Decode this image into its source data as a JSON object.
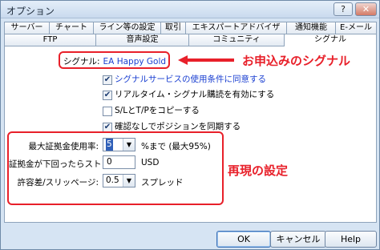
{
  "window": {
    "title": "オプション",
    "help_glyph": "?",
    "close_glyph": "✕"
  },
  "tabs_row1": [
    "サーバー",
    "チャート",
    "ライン等の設定",
    "取引",
    "エキスパートアドバイザ",
    "通知機能",
    "E-メール"
  ],
  "tabs_row2": [
    "FTP",
    "音声設定",
    "コミュニティ",
    "シグナル"
  ],
  "active_tab": "シグナル",
  "signal": {
    "label": "シグナル:",
    "name": "EA Happy Gold"
  },
  "annotations": {
    "callout_signal": "お申込みのシグナル",
    "callout_settings": "再現の設定",
    "accent_color": "#e8202a"
  },
  "checkboxes": [
    {
      "label": "シグナルサービスの使用条件に同意する",
      "checked": true,
      "link": true
    },
    {
      "label": "リアルタイム・シグナル購読を有効にする",
      "checked": true,
      "link": false
    },
    {
      "label": "S/LとT/Pをコピーする",
      "checked": false,
      "link": false
    },
    {
      "label": "確認なしでポジションを同期する",
      "checked": true,
      "link": false
    }
  ],
  "fields": {
    "max_deposit": {
      "label": "最大証拠金使用率:",
      "value": "5",
      "unit": "%まで (最大95%)"
    },
    "stop_out": {
      "label": "証拠金が下回ったらストップ:",
      "value": "0",
      "unit": "USD"
    },
    "slippage": {
      "label": "許容差/スリッページ:",
      "value": "0.5",
      "unit": "スプレッド"
    }
  },
  "buttons": {
    "ok": "OK",
    "cancel": "キャンセル",
    "help": "Help"
  }
}
